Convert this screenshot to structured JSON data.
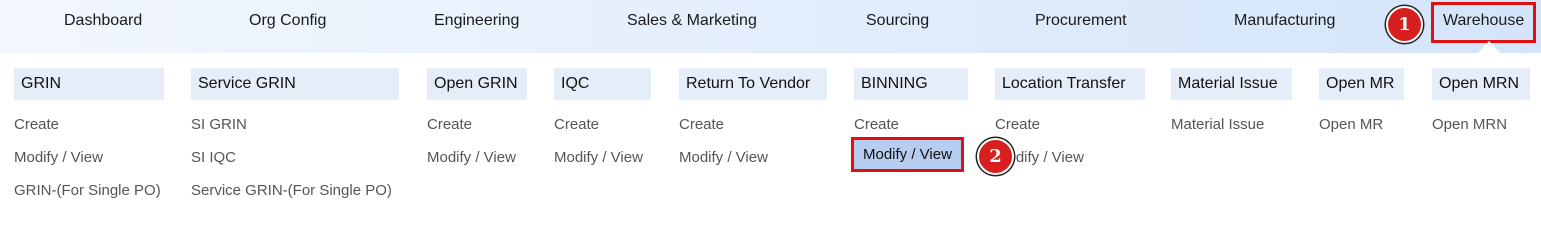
{
  "nav": {
    "items": [
      "Dashboard",
      "Org Config",
      "Engineering",
      "Sales & Marketing",
      "Sourcing",
      "Procurement",
      "Manufacturing",
      "Warehouse"
    ]
  },
  "menu": {
    "grin": {
      "title": "GRIN",
      "links": [
        "Create",
        "Modify / View",
        "GRIN-(For Single PO)"
      ]
    },
    "service_grin": {
      "title": "Service GRIN",
      "links": [
        "SI GRIN",
        "SI IQC",
        "Service GRIN-(For Single PO)"
      ]
    },
    "open_grin": {
      "title": "Open GRIN",
      "links": [
        "Create",
        "Modify / View"
      ]
    },
    "iqc": {
      "title": "IQC",
      "links": [
        "Create",
        "Modify / View"
      ]
    },
    "rtv": {
      "title": "Return To Vendor",
      "links": [
        "Create",
        "Modify / View"
      ]
    },
    "binning": {
      "title": "BINNING",
      "links": [
        "Create",
        "Modify / View"
      ]
    },
    "location_transfer": {
      "title": "Location Transfer",
      "links": [
        "Create",
        "Modify / View"
      ]
    },
    "material_issue": {
      "title": "Material Issue",
      "links": [
        "Material Issue"
      ]
    },
    "open_mr": {
      "title": "Open MR",
      "links": [
        "Open MR"
      ]
    },
    "open_mrn": {
      "title": "Open MRN",
      "links": [
        "Open MRN"
      ]
    }
  },
  "annotations": {
    "step1": "1",
    "step2": "2"
  },
  "colors": {
    "highlight_border": "#e01010",
    "badge": "#d81f1f",
    "selected_bg": "#b7cdf0",
    "header_bg": "#e5edf9"
  }
}
